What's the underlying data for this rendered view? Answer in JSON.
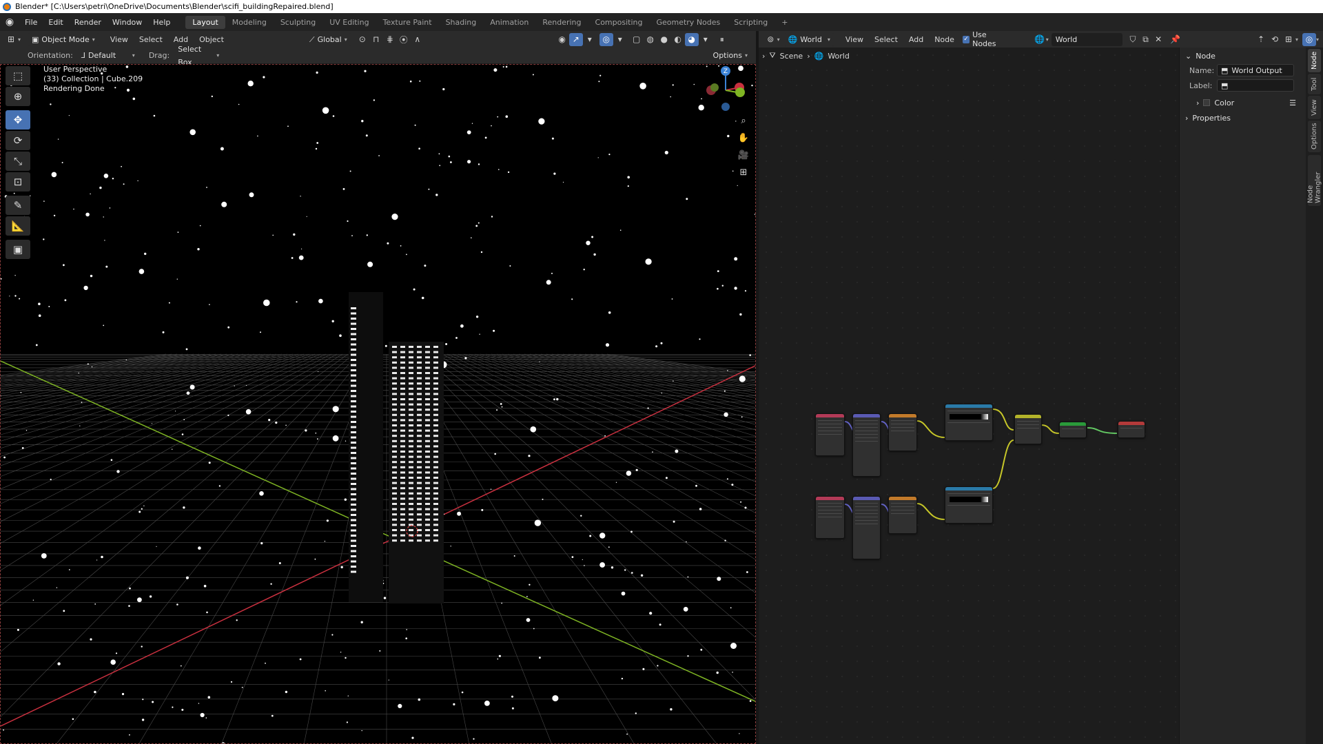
{
  "window": {
    "title": "Blender* [C:\\Users\\petri\\OneDrive\\Documents\\Blender\\scifi_buildingRepaired.blend]"
  },
  "menu": {
    "items": [
      "File",
      "Edit",
      "Render",
      "Window",
      "Help"
    ]
  },
  "workspaces": {
    "tabs": [
      "Layout",
      "Modeling",
      "Sculpting",
      "UV Editing",
      "Texture Paint",
      "Shading",
      "Animation",
      "Rendering",
      "Compositing",
      "Geometry Nodes",
      "Scripting"
    ],
    "active": "Layout",
    "add": "+"
  },
  "viewport_header": {
    "mode": "Object Mode",
    "menus": [
      "View",
      "Select",
      "Add",
      "Object"
    ],
    "transform_orientation": "Global",
    "orientation_label": "Orientation:",
    "orientation_value": "Default",
    "drag_label": "Drag:",
    "drag_value": "Select Box",
    "options": "Options"
  },
  "viewport_overlay": {
    "line1": "User Perspective",
    "line2": "(33) Collection | Cube.209",
    "line3": "Rendering Done"
  },
  "gizmo": {
    "z": "Z"
  },
  "node_editor_header": {
    "type": "World",
    "menus": [
      "View",
      "Select",
      "Add",
      "Node"
    ],
    "use_nodes": "Use Nodes",
    "datablock": "World"
  },
  "breadcrumb": {
    "scene": "Scene",
    "world": "World"
  },
  "npanel": {
    "node_section": "Node",
    "name_label": "Name:",
    "name_value": "World Output",
    "label_label": "Label:",
    "label_value": "",
    "color_section": "Color",
    "properties_section": "Properties"
  },
  "npanel_tabs": [
    "Node",
    "Tool",
    "View",
    "Options",
    "Node Wrangler"
  ],
  "colors": {
    "accent": "#4772b3",
    "x_axis": "#c9303f",
    "y_axis": "#7fb523",
    "z_axis": "#3b82d6"
  }
}
